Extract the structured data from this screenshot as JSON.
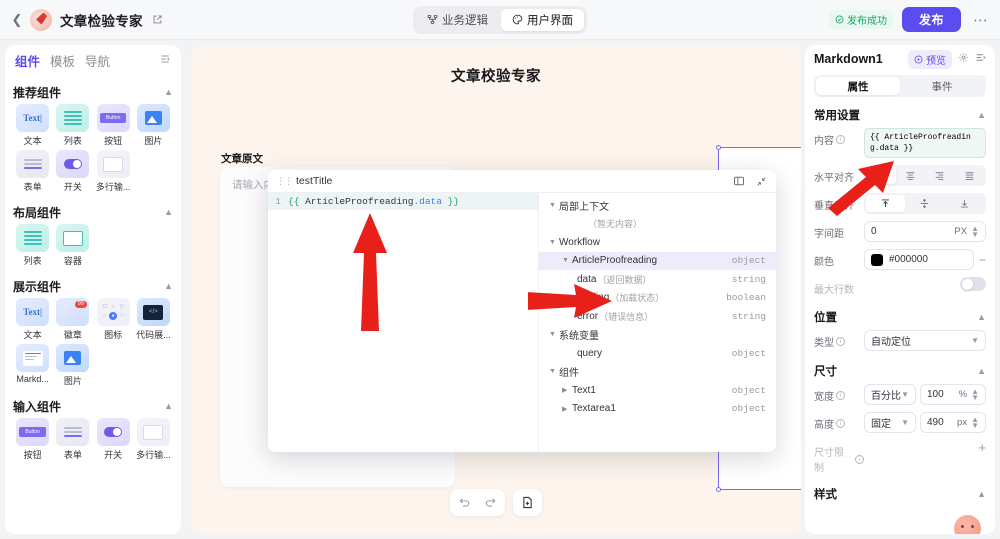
{
  "topbar": {
    "back_icon": "chevron-left-icon",
    "app_title": "文章检验专家",
    "edit_icon": "edit-square-icon",
    "tabs": [
      {
        "label": "业务逻辑",
        "icon": "flow-icon",
        "active": false
      },
      {
        "label": "用户界面",
        "icon": "palette-icon",
        "active": true
      }
    ],
    "publish_status": "发布成功",
    "publish_button": "发布",
    "more_icon": "ellipsis-icon"
  },
  "sidebar": {
    "tabs": [
      {
        "label": "组件",
        "active": true
      },
      {
        "label": "模板",
        "active": false
      },
      {
        "label": "导航",
        "active": false
      }
    ],
    "collapse_icon": "panel-collapse-icon",
    "sections": [
      {
        "title": "推荐组件",
        "items": [
          {
            "label": "文本",
            "icon": "text-icon"
          },
          {
            "label": "列表",
            "icon": "list-icon"
          },
          {
            "label": "按钮",
            "icon": "button-icon"
          },
          {
            "label": "图片",
            "icon": "image-icon"
          },
          {
            "label": "表单",
            "icon": "form-icon"
          },
          {
            "label": "开关",
            "icon": "switch-icon"
          },
          {
            "label": "多行输...",
            "icon": "textarea-icon"
          }
        ]
      },
      {
        "title": "布局组件",
        "items": [
          {
            "label": "列表",
            "icon": "list-icon"
          },
          {
            "label": "容器",
            "icon": "container-icon"
          }
        ]
      },
      {
        "title": "展示组件",
        "items": [
          {
            "label": "文本",
            "icon": "text-icon"
          },
          {
            "label": "徽章",
            "icon": "badge-icon"
          },
          {
            "label": "图标",
            "icon": "icon-set-icon"
          },
          {
            "label": "代码展...",
            "icon": "code-display-icon"
          },
          {
            "label": "Markd...",
            "icon": "markdown-icon"
          },
          {
            "label": "图片",
            "icon": "image-icon"
          }
        ]
      },
      {
        "title": "输入组件",
        "items": [
          {
            "label": "按钮",
            "icon": "button-icon"
          },
          {
            "label": "表单",
            "icon": "form-icon"
          },
          {
            "label": "开关",
            "icon": "switch-icon"
          },
          {
            "label": "多行输...",
            "icon": "textarea-icon"
          }
        ]
      }
    ]
  },
  "canvas": {
    "page_title": "文章校验专家",
    "field_label": "文章原文",
    "textarea_placeholder": "请输入内容",
    "toolbar": {
      "undo_icon": "undo-icon",
      "redo_icon": "redo-icon",
      "add_page_icon": "add-page-icon"
    }
  },
  "modal": {
    "title": "testTitle",
    "drag_icon": "drag-handle-icon",
    "split_icon": "split-panel-icon",
    "collapse_icon": "collapse-diagonal-icon",
    "code": {
      "line_number": "1",
      "open_brace": "{{",
      "object": " ArticleProofreading",
      "property": ".data",
      "close_brace": " }}"
    },
    "tree": [
      {
        "depth": 1,
        "caret": "down",
        "label": "局部上下文",
        "desc": "",
        "type": ""
      },
      {
        "depth": 3,
        "caret": "none",
        "label": "（暂无内容）",
        "desc": "",
        "type": ""
      },
      {
        "depth": 1,
        "caret": "down",
        "label": "Workflow",
        "desc": "",
        "type": ""
      },
      {
        "depth": 2,
        "caret": "down",
        "label": "ArticleProofreading",
        "desc": "",
        "type": "object",
        "highlight": true
      },
      {
        "depth": 3,
        "caret": "none",
        "label": "data",
        "desc": "（返回数据）",
        "type": "string"
      },
      {
        "depth": 3,
        "caret": "none",
        "label": "loading",
        "desc": "（加载状态）",
        "type": "boolean"
      },
      {
        "depth": 3,
        "caret": "none",
        "label": "error",
        "desc": "（错误信息）",
        "type": "string"
      },
      {
        "depth": 1,
        "caret": "down",
        "label": "系统变量",
        "desc": "",
        "type": ""
      },
      {
        "depth": 2,
        "caret": "none",
        "label": "query",
        "desc": "",
        "type": "object"
      },
      {
        "depth": 1,
        "caret": "down",
        "label": "组件",
        "desc": "",
        "type": ""
      },
      {
        "depth": 2,
        "caret": "right",
        "label": "Text1",
        "desc": "",
        "type": "object"
      },
      {
        "depth": 2,
        "caret": "right",
        "label": "Textarea1",
        "desc": "",
        "type": "object"
      }
    ]
  },
  "rightpanel": {
    "component_name": "Markdown1",
    "preview_label": "预览",
    "settings_icon": "gear-icon",
    "list_icon": "list-lines-icon",
    "segments": [
      {
        "label": "属性",
        "active": true
      },
      {
        "label": "事件",
        "active": false
      }
    ],
    "common_settings": {
      "title": "常用设置",
      "content_label": "内容",
      "content_value": "{{ ArticleProofreading.data }}",
      "halign_label": "水平对齐",
      "halign_options": [
        "align-left",
        "align-center",
        "align-right",
        "align-justify"
      ],
      "halign_selected": 0,
      "valign_label": "垂直对齐",
      "valign_options": [
        "align-top",
        "align-middle",
        "align-bottom"
      ],
      "valign_selected": 0,
      "letterspacing_label": "字间距",
      "letterspacing_value": "0",
      "letterspacing_unit": "PX",
      "color_label": "颜色",
      "color_value": "#000000",
      "maxlines_label": "最大行数",
      "maxlines_on": false
    },
    "position": {
      "title": "位置",
      "type_label": "类型",
      "type_value": "自动定位"
    },
    "size": {
      "title": "尺寸",
      "width_label": "宽度",
      "width_mode": "百分比",
      "width_value": "100",
      "width_unit": "%",
      "height_label": "高度",
      "height_mode": "固定",
      "height_value": "490",
      "height_unit": "px",
      "constraint_label": "尺寸限制"
    },
    "style": {
      "title": "样式"
    },
    "avatar_icon": "assistant-avatar-icon"
  },
  "colors": {
    "accent": "#5b4cf0",
    "success": "#17a666",
    "canvas_bg": "#fdf5ed",
    "arrow": "#e8201a",
    "text_color_value": "#000000"
  }
}
